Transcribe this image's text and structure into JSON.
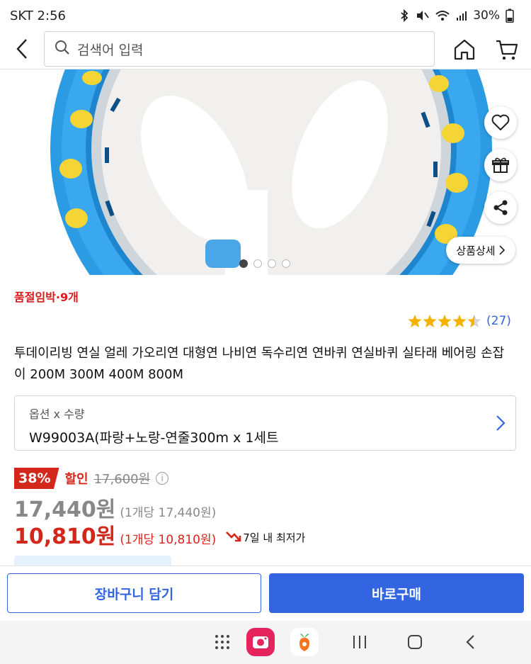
{
  "status_bar": {
    "carrier_time": "SKT 2:56",
    "battery": "30%"
  },
  "top_nav": {
    "search_placeholder": "검색어 입력"
  },
  "image": {
    "detail_button": "상품상세"
  },
  "soldout_notice": "품절임박·9개",
  "rating": {
    "stars": 4.5,
    "count": "(27)"
  },
  "product_title": "투데이리빙 연실 얼레 가오리연 대형연 나비연 독수리연 연바퀴 연실바퀴 실타래 베어링 손잡이 200M 300M 400M 800M",
  "option": {
    "label": "옵션 x 수량",
    "value": "W99003A(파랑+노랑-연줄300m x 1세트"
  },
  "price": {
    "discount_rate": "38%",
    "discount_label": "할인",
    "original": "17,600원",
    "sale": "17,440원",
    "sale_unit": "(1개당 17,440원)",
    "coupon": "10,810원",
    "coupon_unit": "(1개당 10,810원)",
    "lowest_label": "7일 내 최저가"
  },
  "bottom_bar": {
    "add_to_cart": "장바구니 담기",
    "buy_now": "바로구매"
  },
  "colors": {
    "accent_blue": "#3365e0",
    "sale_red": "#d4271b",
    "star_yellow": "#f5b301"
  }
}
